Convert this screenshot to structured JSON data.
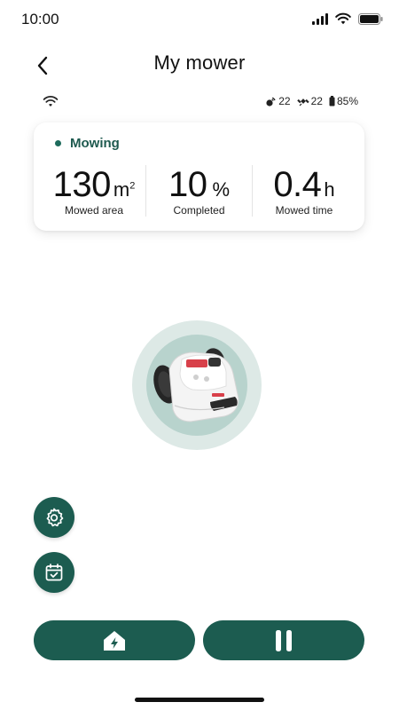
{
  "status_bar": {
    "time": "10:00"
  },
  "header": {
    "title": "My mower"
  },
  "connection": {
    "gps_count": "22",
    "satellite_count": "22",
    "battery": "85%"
  },
  "stats": {
    "status": "Mowing",
    "items": [
      {
        "value": "130",
        "unit": "m",
        "unit_sup": "2",
        "label": "Mowed area"
      },
      {
        "value": "10",
        "unit": "%",
        "unit_sup": "",
        "label": "Completed"
      },
      {
        "value": "0.4",
        "unit": "h",
        "unit_sup": "",
        "label": "Mowed time"
      }
    ]
  },
  "mower": {
    "brand": "LEAPRO"
  },
  "colors": {
    "primary": "#1c5c50",
    "ring_outer": "#dde9e6",
    "ring_inner": "#b8d3cd"
  },
  "icons": {
    "settings": "gear-icon",
    "schedule": "calendar-check-icon",
    "home": "home-charge-icon",
    "pause": "pause-icon"
  }
}
